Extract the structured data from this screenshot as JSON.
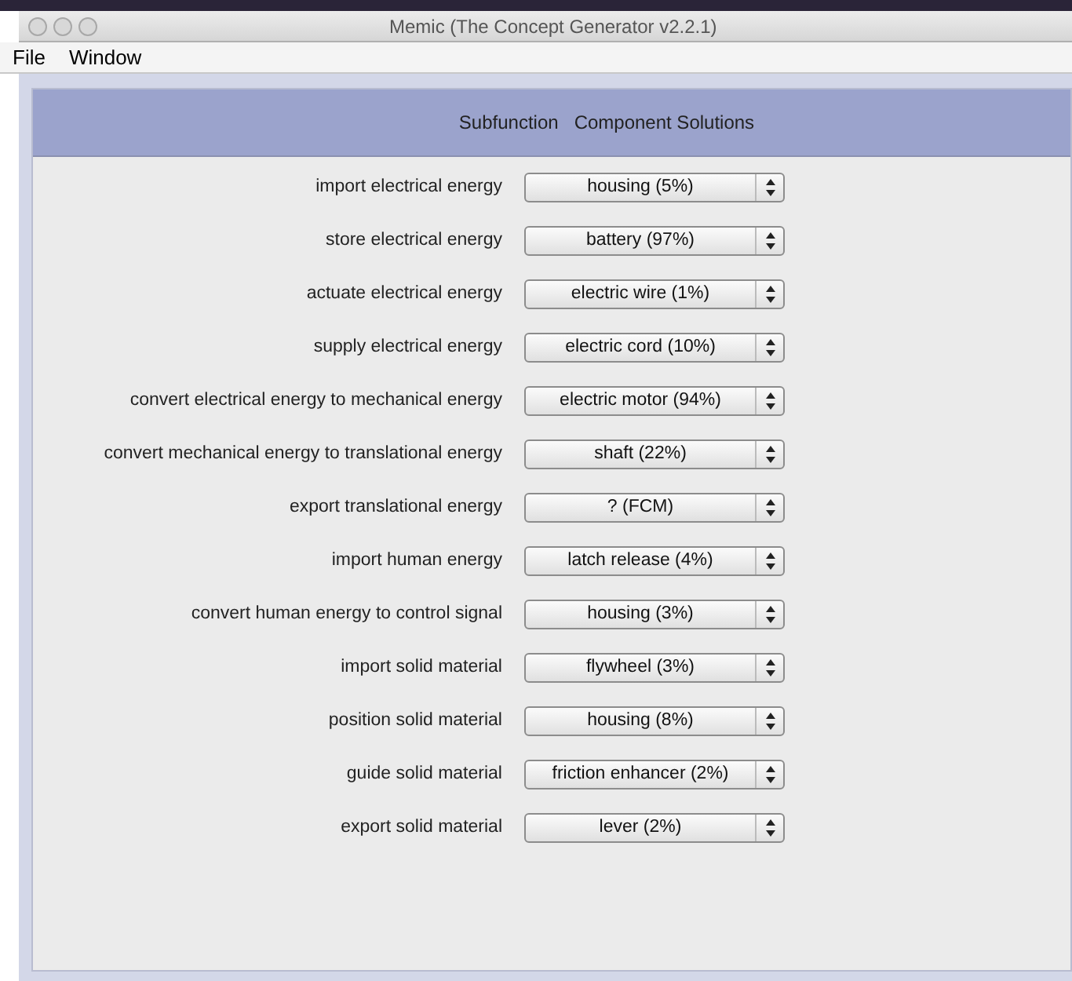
{
  "window": {
    "title": "Memic (The Concept Generator v2.2.1)"
  },
  "menu": [
    "File",
    "Window"
  ],
  "header": {
    "columns": [
      "Subfunction",
      "Component Solutions"
    ]
  },
  "rows": [
    {
      "subfunction": "import electrical energy",
      "solution": "housing (5%)"
    },
    {
      "subfunction": "store electrical energy",
      "solution": "battery (97%)"
    },
    {
      "subfunction": "actuate electrical energy",
      "solution": "electric wire (1%)"
    },
    {
      "subfunction": "supply electrical energy",
      "solution": "electric cord (10%)"
    },
    {
      "subfunction": "convert electrical energy to mechanical energy",
      "solution": "electric motor (94%)"
    },
    {
      "subfunction": "convert mechanical energy to translational energy",
      "solution": "shaft (22%)"
    },
    {
      "subfunction": "export translational energy",
      "solution": "? (FCM)"
    },
    {
      "subfunction": "import human energy",
      "solution": "latch release (4%)"
    },
    {
      "subfunction": "convert human energy to control signal",
      "solution": "housing (3%)"
    },
    {
      "subfunction": "import solid material",
      "solution": "flywheel (3%)"
    },
    {
      "subfunction": "position solid material",
      "solution": "housing (8%)"
    },
    {
      "subfunction": "guide solid material",
      "solution": "friction enhancer (2%)"
    },
    {
      "subfunction": "export solid material",
      "solution": "lever (2%)"
    }
  ]
}
